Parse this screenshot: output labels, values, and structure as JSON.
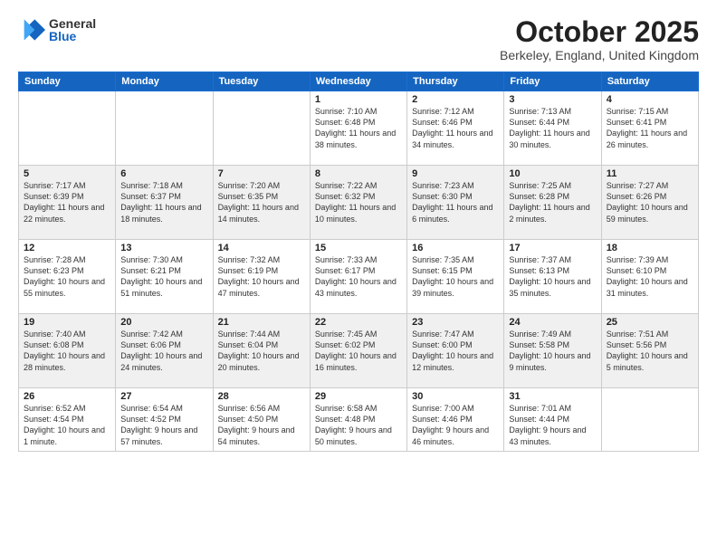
{
  "logo": {
    "general": "General",
    "blue": "Blue"
  },
  "title": "October 2025",
  "subtitle": "Berkeley, England, United Kingdom",
  "days_header": [
    "Sunday",
    "Monday",
    "Tuesday",
    "Wednesday",
    "Thursday",
    "Friday",
    "Saturday"
  ],
  "weeks": [
    [
      {
        "day": "",
        "info": ""
      },
      {
        "day": "",
        "info": ""
      },
      {
        "day": "",
        "info": ""
      },
      {
        "day": "1",
        "info": "Sunrise: 7:10 AM\nSunset: 6:48 PM\nDaylight: 11 hours\nand 38 minutes."
      },
      {
        "day": "2",
        "info": "Sunrise: 7:12 AM\nSunset: 6:46 PM\nDaylight: 11 hours\nand 34 minutes."
      },
      {
        "day": "3",
        "info": "Sunrise: 7:13 AM\nSunset: 6:44 PM\nDaylight: 11 hours\nand 30 minutes."
      },
      {
        "day": "4",
        "info": "Sunrise: 7:15 AM\nSunset: 6:41 PM\nDaylight: 11 hours\nand 26 minutes."
      }
    ],
    [
      {
        "day": "5",
        "info": "Sunrise: 7:17 AM\nSunset: 6:39 PM\nDaylight: 11 hours\nand 22 minutes."
      },
      {
        "day": "6",
        "info": "Sunrise: 7:18 AM\nSunset: 6:37 PM\nDaylight: 11 hours\nand 18 minutes."
      },
      {
        "day": "7",
        "info": "Sunrise: 7:20 AM\nSunset: 6:35 PM\nDaylight: 11 hours\nand 14 minutes."
      },
      {
        "day": "8",
        "info": "Sunrise: 7:22 AM\nSunset: 6:32 PM\nDaylight: 11 hours\nand 10 minutes."
      },
      {
        "day": "9",
        "info": "Sunrise: 7:23 AM\nSunset: 6:30 PM\nDaylight: 11 hours\nand 6 minutes."
      },
      {
        "day": "10",
        "info": "Sunrise: 7:25 AM\nSunset: 6:28 PM\nDaylight: 11 hours\nand 2 minutes."
      },
      {
        "day": "11",
        "info": "Sunrise: 7:27 AM\nSunset: 6:26 PM\nDaylight: 10 hours\nand 59 minutes."
      }
    ],
    [
      {
        "day": "12",
        "info": "Sunrise: 7:28 AM\nSunset: 6:23 PM\nDaylight: 10 hours\nand 55 minutes."
      },
      {
        "day": "13",
        "info": "Sunrise: 7:30 AM\nSunset: 6:21 PM\nDaylight: 10 hours\nand 51 minutes."
      },
      {
        "day": "14",
        "info": "Sunrise: 7:32 AM\nSunset: 6:19 PM\nDaylight: 10 hours\nand 47 minutes."
      },
      {
        "day": "15",
        "info": "Sunrise: 7:33 AM\nSunset: 6:17 PM\nDaylight: 10 hours\nand 43 minutes."
      },
      {
        "day": "16",
        "info": "Sunrise: 7:35 AM\nSunset: 6:15 PM\nDaylight: 10 hours\nand 39 minutes."
      },
      {
        "day": "17",
        "info": "Sunrise: 7:37 AM\nSunset: 6:13 PM\nDaylight: 10 hours\nand 35 minutes."
      },
      {
        "day": "18",
        "info": "Sunrise: 7:39 AM\nSunset: 6:10 PM\nDaylight: 10 hours\nand 31 minutes."
      }
    ],
    [
      {
        "day": "19",
        "info": "Sunrise: 7:40 AM\nSunset: 6:08 PM\nDaylight: 10 hours\nand 28 minutes."
      },
      {
        "day": "20",
        "info": "Sunrise: 7:42 AM\nSunset: 6:06 PM\nDaylight: 10 hours\nand 24 minutes."
      },
      {
        "day": "21",
        "info": "Sunrise: 7:44 AM\nSunset: 6:04 PM\nDaylight: 10 hours\nand 20 minutes."
      },
      {
        "day": "22",
        "info": "Sunrise: 7:45 AM\nSunset: 6:02 PM\nDaylight: 10 hours\nand 16 minutes."
      },
      {
        "day": "23",
        "info": "Sunrise: 7:47 AM\nSunset: 6:00 PM\nDaylight: 10 hours\nand 12 minutes."
      },
      {
        "day": "24",
        "info": "Sunrise: 7:49 AM\nSunset: 5:58 PM\nDaylight: 10 hours\nand 9 minutes."
      },
      {
        "day": "25",
        "info": "Sunrise: 7:51 AM\nSunset: 5:56 PM\nDaylight: 10 hours\nand 5 minutes."
      }
    ],
    [
      {
        "day": "26",
        "info": "Sunrise: 6:52 AM\nSunset: 4:54 PM\nDaylight: 10 hours\nand 1 minute."
      },
      {
        "day": "27",
        "info": "Sunrise: 6:54 AM\nSunset: 4:52 PM\nDaylight: 9 hours\nand 57 minutes."
      },
      {
        "day": "28",
        "info": "Sunrise: 6:56 AM\nSunset: 4:50 PM\nDaylight: 9 hours\nand 54 minutes."
      },
      {
        "day": "29",
        "info": "Sunrise: 6:58 AM\nSunset: 4:48 PM\nDaylight: 9 hours\nand 50 minutes."
      },
      {
        "day": "30",
        "info": "Sunrise: 7:00 AM\nSunset: 4:46 PM\nDaylight: 9 hours\nand 46 minutes."
      },
      {
        "day": "31",
        "info": "Sunrise: 7:01 AM\nSunset: 4:44 PM\nDaylight: 9 hours\nand 43 minutes."
      },
      {
        "day": "",
        "info": ""
      }
    ]
  ]
}
